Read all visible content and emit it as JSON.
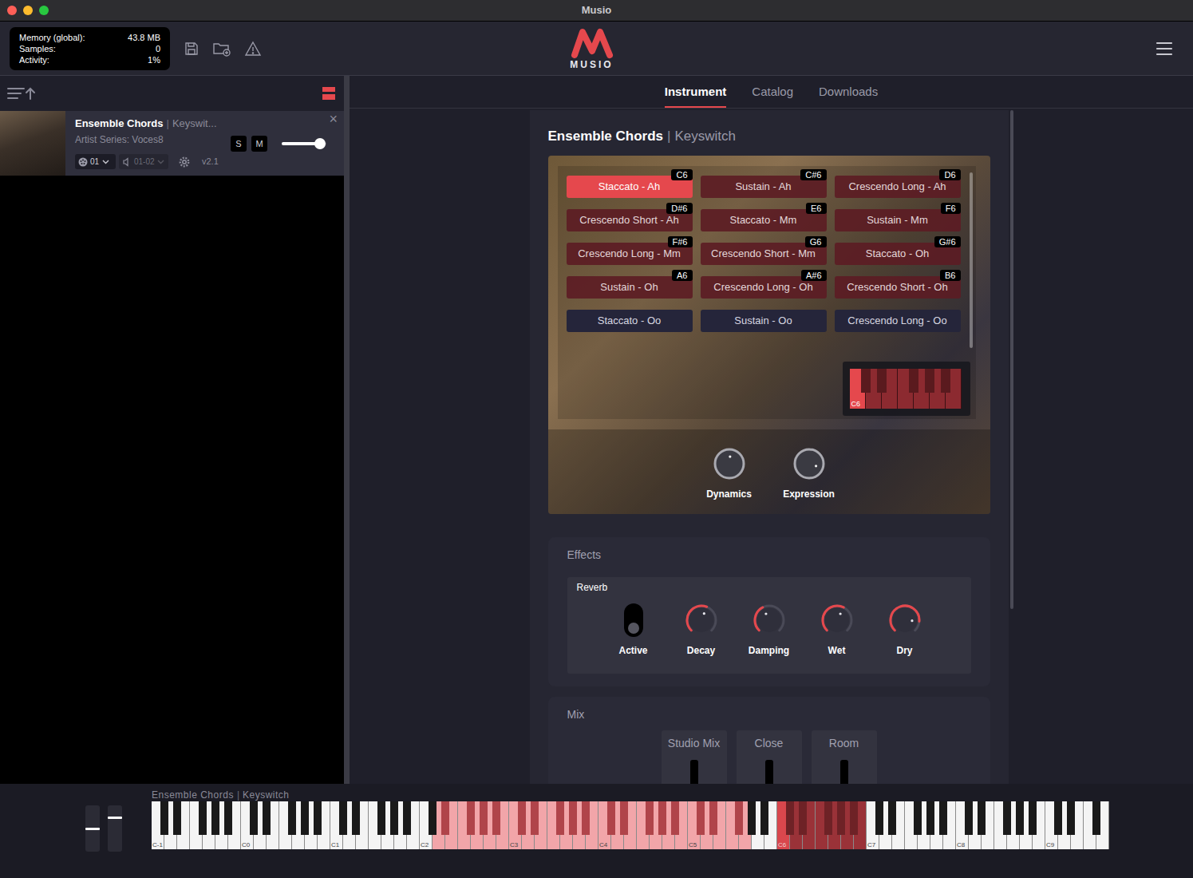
{
  "window": {
    "title": "Musio"
  },
  "header": {
    "stats": [
      {
        "label": "Memory (global):",
        "value": "43.8 MB"
      },
      {
        "label": "Samples:",
        "value": "0"
      },
      {
        "label": "Activity:",
        "value": "1%"
      }
    ],
    "logo": "MUSIO"
  },
  "rack": {
    "instruments": [
      {
        "title": "Ensemble Chords",
        "separator": "|",
        "variant": "Keyswit...",
        "subtitle": "Artist Series: Voces8",
        "solo_label": "S",
        "mute_label": "M",
        "solo": false,
        "mute": false,
        "volume": {
          "level": 0.85
        },
        "midi_channel": "01",
        "output": "01-02",
        "version": "v2.1",
        "close": "×",
        "selected": true
      }
    ]
  },
  "tabs": [
    {
      "label": "Instrument",
      "selected": true
    },
    {
      "label": "Catalog",
      "selected": false
    },
    {
      "label": "Downloads",
      "selected": false
    }
  ],
  "instrument": {
    "title": "Ensemble Chords",
    "separator": "|",
    "variant": "Keyswitch",
    "articulations": [
      {
        "label": "Staccato - Ah",
        "key": "C6",
        "mapped": true,
        "selected": true
      },
      {
        "label": "Sustain - Ah",
        "key": "C#6",
        "mapped": true,
        "selected": false
      },
      {
        "label": "Crescendo Long - Ah",
        "key": "D6",
        "mapped": true,
        "selected": false
      },
      {
        "label": "Crescendo Short - Ah",
        "key": "D#6",
        "mapped": true,
        "selected": false
      },
      {
        "label": "Staccato - Mm",
        "key": "E6",
        "mapped": true,
        "selected": false
      },
      {
        "label": "Sustain - Mm",
        "key": "F6",
        "mapped": true,
        "selected": false
      },
      {
        "label": "Crescendo Long - Mm",
        "key": "F#6",
        "mapped": true,
        "selected": false
      },
      {
        "label": "Crescendo Short - Mm",
        "key": "G6",
        "mapped": true,
        "selected": false
      },
      {
        "label": "Staccato - Oh",
        "key": "G#6",
        "mapped": true,
        "selected": false
      },
      {
        "label": "Sustain - Oh",
        "key": "A6",
        "mapped": true,
        "selected": false
      },
      {
        "label": "Crescendo Long - Oh",
        "key": "A#6",
        "mapped": true,
        "selected": false
      },
      {
        "label": "Crescendo Short - Oh",
        "key": "B6",
        "mapped": true,
        "selected": false
      },
      {
        "label": "Staccato - Oo",
        "mapped": false,
        "selected": false
      },
      {
        "label": "Sustain - Oo",
        "mapped": false,
        "selected": false
      },
      {
        "label": "Crescendo Long - Oo",
        "mapped": false,
        "selected": false
      }
    ],
    "mini_keyboard": {
      "label": "C6",
      "active_key": 0
    },
    "knobs": [
      {
        "label": "Dynamics",
        "level": 0.52
      },
      {
        "label": "Expression",
        "level": 0.9
      }
    ]
  },
  "effects": {
    "title": "Effects",
    "reverb": {
      "title": "Reverb",
      "active": {
        "label": "Active",
        "on": false
      },
      "knobs": [
        {
          "label": "Decay",
          "level": 0.58
        },
        {
          "label": "Damping",
          "level": 0.4
        },
        {
          "label": "Wet",
          "level": 0.6
        },
        {
          "label": "Dry",
          "level": 0.85
        }
      ]
    }
  },
  "mix": {
    "title": "Mix",
    "channels": [
      "Studio Mix",
      "Close",
      "Room"
    ]
  },
  "keyboard": {
    "title": "Ensemble Chords",
    "separator": "|",
    "variant": "Keyswitch",
    "pitch": {
      "level": 0.5
    },
    "mod": {
      "level": 0.74
    },
    "octave_labels": [
      "C-1",
      "C0",
      "C1",
      "C2",
      "C3",
      "C4",
      "C5",
      "C6",
      "C7",
      "C8",
      "C9"
    ],
    "playable": [
      38,
      79
    ],
    "keyswitches": [
      84,
      95
    ],
    "active_key": 84
  }
}
